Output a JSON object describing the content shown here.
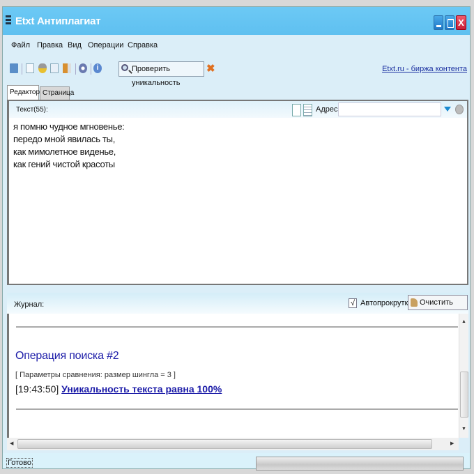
{
  "window": {
    "title": "Etxt Антиплагиат",
    "close_glyph": "X"
  },
  "menu": [
    "Файл",
    "Правка",
    "Вид",
    "Операции",
    "Справка"
  ],
  "toolbar": {
    "icons": [
      "open-folder-icon",
      "new-document-icon",
      "cut-icon",
      "copy-icon",
      "paste-icon",
      "settings-icon",
      "info-icon"
    ],
    "check_button": "Проверить уникальность",
    "stop_glyph": "✖",
    "site_link": "Etxt.ru - биржа контента"
  },
  "tabs": [
    {
      "label": "Редактор",
      "active": true
    },
    {
      "label": "Страница",
      "active": false
    }
  ],
  "editor": {
    "label": "Текст(55):",
    "address_label": "Адрес:",
    "address_value": "",
    "text": "я помню чудное мгновенье:\nпередо мной явилась ты,\nкак мимолетное виденье,\nкак гений чистой красоты"
  },
  "log": {
    "label": "Журнал:",
    "autoscroll_label": "Автопрокрутка",
    "autoscroll_checked": true,
    "check_glyph": "√",
    "clear_button": "Очистить журнал",
    "operation_title": "Операция поиска #2",
    "params": "[ Параметры сравнения: размер шингла = 3 ]",
    "timestamp": "[19:43:50]",
    "result": "Уникальность текста равна 100%"
  },
  "status": {
    "text": "Готово"
  }
}
